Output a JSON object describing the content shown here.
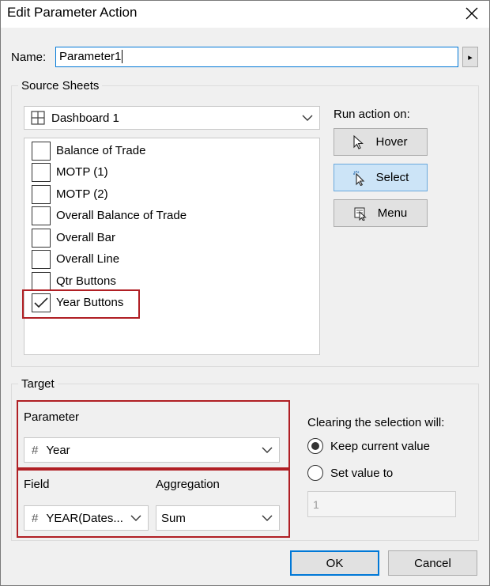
{
  "dialog": {
    "title": "Edit Parameter Action"
  },
  "name": {
    "label": "Name:",
    "value": "Parameter1",
    "more_glyph": "▸"
  },
  "source": {
    "group_label": "Source Sheets",
    "sheet_dropdown": "Dashboard 1",
    "sheets": [
      {
        "label": "Balance of Trade",
        "checked": false
      },
      {
        "label": "MOTP (1)",
        "checked": false
      },
      {
        "label": "MOTP (2)",
        "checked": false
      },
      {
        "label": "Overall Balance of Trade",
        "checked": false
      },
      {
        "label": "Overall Bar",
        "checked": false
      },
      {
        "label": "Overall Line",
        "checked": false
      },
      {
        "label": "Qtr Buttons",
        "checked": false
      },
      {
        "label": "Year Buttons",
        "checked": true
      }
    ],
    "run_action_label": "Run action on:",
    "run_buttons": [
      {
        "label": "Hover",
        "icon": "cursor-icon",
        "selected": false
      },
      {
        "label": "Select",
        "icon": "select-cursor-icon",
        "selected": true
      },
      {
        "label": "Menu",
        "icon": "menu-cursor-icon",
        "selected": false
      }
    ]
  },
  "target": {
    "group_label": "Target",
    "parameter_label": "Parameter",
    "parameter_value": "Year",
    "field_label": "Field",
    "field_value": "YEAR(Dates...",
    "aggregation_label": "Aggregation",
    "aggregation_value": "Sum",
    "clearing_label": "Clearing the selection will:",
    "clearing_options": [
      {
        "label": "Keep current value",
        "selected": true
      },
      {
        "label": "Set value to",
        "selected": false
      }
    ],
    "set_value": "1"
  },
  "footer": {
    "ok_label": "OK",
    "cancel_label": "Cancel"
  },
  "colors": {
    "highlight_box": "#b01f24",
    "selected_button": "#cce4f7",
    "default_button_border": "#0078d7"
  }
}
